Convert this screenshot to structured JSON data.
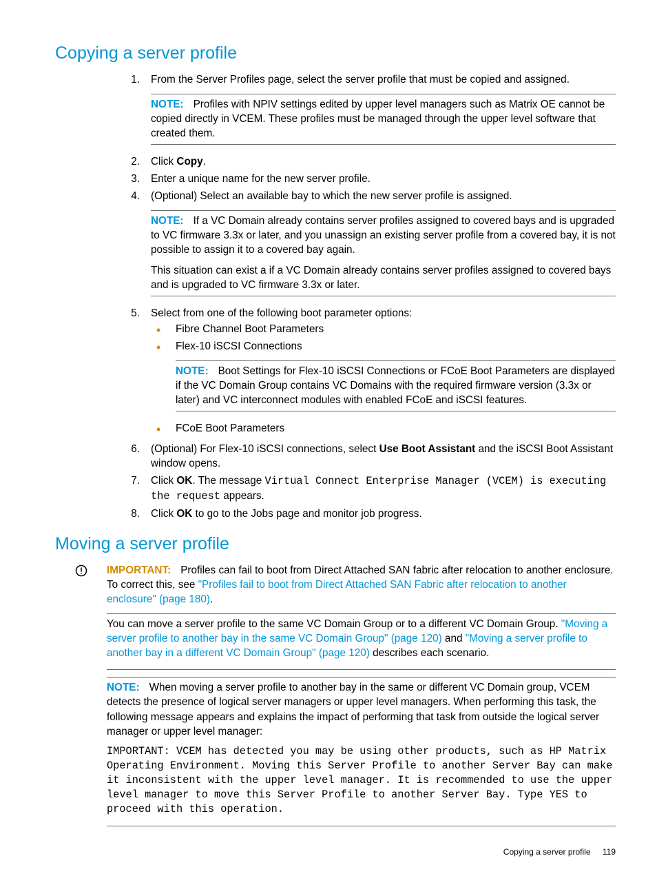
{
  "section1": {
    "title": "Copying a server profile",
    "steps": {
      "s1": {
        "num": "1.",
        "text": "From the Server Profiles page, select the server profile that must be copied and assigned."
      },
      "s1note": {
        "label": "NOTE:",
        "text": "Profiles with NPIV settings edited by upper level managers such as Matrix OE cannot be copied directly in VCEM. These profiles must be managed through the upper level software that created them."
      },
      "s2": {
        "num": "2.",
        "pre": "Click ",
        "bold": "Copy",
        "post": "."
      },
      "s3": {
        "num": "3.",
        "text": "Enter a unique name for the new server profile."
      },
      "s4": {
        "num": "4.",
        "text": "(Optional) Select an available bay to which the new server profile is assigned."
      },
      "s4note": {
        "label": "NOTE:",
        "p1": "If a VC Domain already contains server profiles assigned to covered bays and is upgraded to VC firmware 3.3x or later, and you unassign an existing server profile from a covered bay, it is not possible to assign it to a covered bay again.",
        "p2": "This situation can exist a if a VC Domain already contains server profiles assigned to covered bays and is upgraded to VC firmware 3.3x or later."
      },
      "s5": {
        "num": "5.",
        "text": "Select from one of the following boot parameter options:",
        "b1": "Fibre Channel Boot Parameters",
        "b2": "Flex-10 iSCSI Connections",
        "b2note": {
          "label": "NOTE:",
          "text": "Boot Settings for Flex-10 iSCSI Connections or FCoE Boot Parameters are displayed if the VC Domain Group contains VC Domains with the required firmware version (3.3x or later) and VC interconnect modules with enabled FCoE and iSCSI features."
        },
        "b3": "FCoE Boot Parameters"
      },
      "s6": {
        "num": "6.",
        "pre": "(Optional) For Flex-10 iSCSI connections, select ",
        "bold": "Use Boot Assistant",
        "post": " and the iSCSI Boot Assistant window opens."
      },
      "s7": {
        "num": "7.",
        "pre": "Click ",
        "bold": "OK",
        "mid": ". The message ",
        "mono": "Virtual Connect Enterprise Manager (VCEM) is executing the request",
        "post": " appears."
      },
      "s8": {
        "num": "8.",
        "pre": "Click ",
        "bold": "OK",
        "post": " to go to the Jobs page and monitor job progress."
      }
    }
  },
  "section2": {
    "title": "Moving a server profile",
    "important": {
      "label": "IMPORTANT:",
      "pre": "Profiles can fail to boot from Direct Attached SAN fabric after relocation to another enclosure. To correct this, see ",
      "link": "\"Profiles fail to boot from Direct Attached SAN Fabric after relocation to another enclosure\" (page 180)",
      "post": "."
    },
    "para1": {
      "pre": "You can move a server profile to the same VC Domain Group or to a different VC Domain Group. ",
      "link1": "\"Moving a server profile to another bay in the same VC Domain Group\" (page 120)",
      "mid": " and ",
      "link2": "\"Moving a server profile to another bay in a different VC Domain Group\" (page 120)",
      "post": " describes each scenario."
    },
    "note": {
      "label": "NOTE:",
      "text": "When moving a server profile to another bay in the same or different VC Domain group, VCEM detects the presence of logical server managers or upper level managers. When performing this task, the following message appears and explains the impact of performing that task from outside the logical server manager or upper level manager:",
      "mono": "IMPORTANT: VCEM has detected you may be using other products, such as HP Matrix Operating Environment. Moving this Server Profile to another Server Bay can make it inconsistent with the upper level manager. It is recommended to use the upper level manager to move this Server Profile to another Server Bay. Type YES to proceed with this operation."
    }
  },
  "footer": {
    "text": "Copying a server profile",
    "page": "119"
  }
}
